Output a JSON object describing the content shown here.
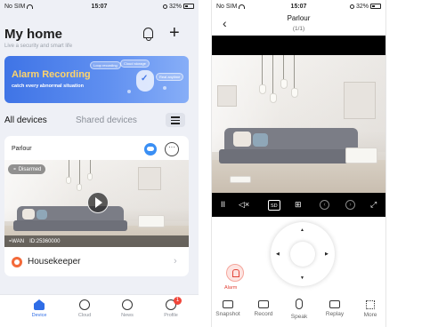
{
  "left_phone": {
    "status": {
      "carrier": "No SIM",
      "time": "15:07",
      "battery": "32%"
    },
    "header": {
      "title": "My home",
      "subtitle": "Live a security and smart life",
      "bell_icon": "bell-icon",
      "add_icon": "plus-icon",
      "add_glyph": "+"
    },
    "banner": {
      "title": "Alarm Recording",
      "subtitle": "catch every abnormal situation",
      "chips": [
        "Loop recording",
        "Cloud storage",
        "Real anytime"
      ]
    },
    "tabs": {
      "all": "All devices",
      "shared": "Shared devices"
    },
    "device_card": {
      "name": "Parlour",
      "status_pill": "Disarmed",
      "network": "WAN",
      "device_id": "ID:25360000",
      "more_glyph": "···"
    },
    "housekeeper": {
      "label": "Housekeeper",
      "chevron": "›"
    },
    "bottom_nav": [
      {
        "label": "Device",
        "icon": "home-icon",
        "active": true
      },
      {
        "label": "Cloud",
        "icon": "cloud-icon"
      },
      {
        "label": "News",
        "icon": "compass-icon"
      },
      {
        "label": "Profile",
        "icon": "profile-icon",
        "badge": "1"
      }
    ],
    "colors": {
      "accent": "#2f6de6",
      "banner": "#4a7de9",
      "banner_title": "#ffd46b",
      "badge": "#f0463a",
      "housekeeper": "#f36a3a"
    }
  },
  "right_phone": {
    "status": {
      "carrier": "No SIM",
      "time": "15:07",
      "battery": "32%"
    },
    "header": {
      "back_glyph": "‹",
      "title": "Parlour",
      "page": "(1/1)"
    },
    "controls": {
      "pause": "II",
      "mute": "◁×",
      "quality": "SD",
      "layout": "⊞",
      "prev": "‹",
      "next": "›",
      "fullscreen": "⤢"
    },
    "ptz": {
      "up": "▲",
      "down": "▼",
      "left": "◀",
      "right": "▶"
    },
    "alarm": {
      "label": "Alarm"
    },
    "tools": [
      {
        "label": "Snapshot",
        "icon": "camera-icon"
      },
      {
        "label": "Record",
        "icon": "video-record-icon"
      },
      {
        "label": "Speak",
        "icon": "microphone-icon"
      },
      {
        "label": "Replay",
        "icon": "film-icon"
      },
      {
        "label": "More",
        "icon": "grid-icon"
      }
    ],
    "colors": {
      "alarm": "#e2453a"
    }
  }
}
